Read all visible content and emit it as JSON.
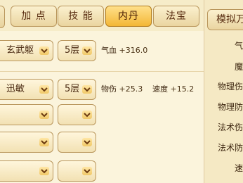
{
  "tabs": [
    {
      "label": "加 点"
    },
    {
      "label": "技 能"
    },
    {
      "label": "内丹"
    },
    {
      "label": "法宝"
    }
  ],
  "simulate_button": "模拟万",
  "rows": [
    {
      "select1": "玄武躯",
      "select2": "5层",
      "stats": [
        {
          "name": "气血",
          "value": "+316.0"
        }
      ]
    },
    {
      "select1": "迅敏",
      "select2": "5层",
      "stats": [
        {
          "name": "物伤",
          "value": "+25.3"
        },
        {
          "name": "速度",
          "value": "+15.2"
        }
      ]
    },
    {
      "select1": "",
      "select2": ""
    },
    {
      "select1": "",
      "select2": ""
    },
    {
      "select1": "",
      "select2": ""
    }
  ],
  "right_stats": [
    "气",
    "魔",
    "物理伤",
    "物理防",
    "法术伤",
    "法术防",
    "速"
  ],
  "colors": {
    "active_tab": "#f3b736",
    "panel": "#fbf4dc"
  }
}
